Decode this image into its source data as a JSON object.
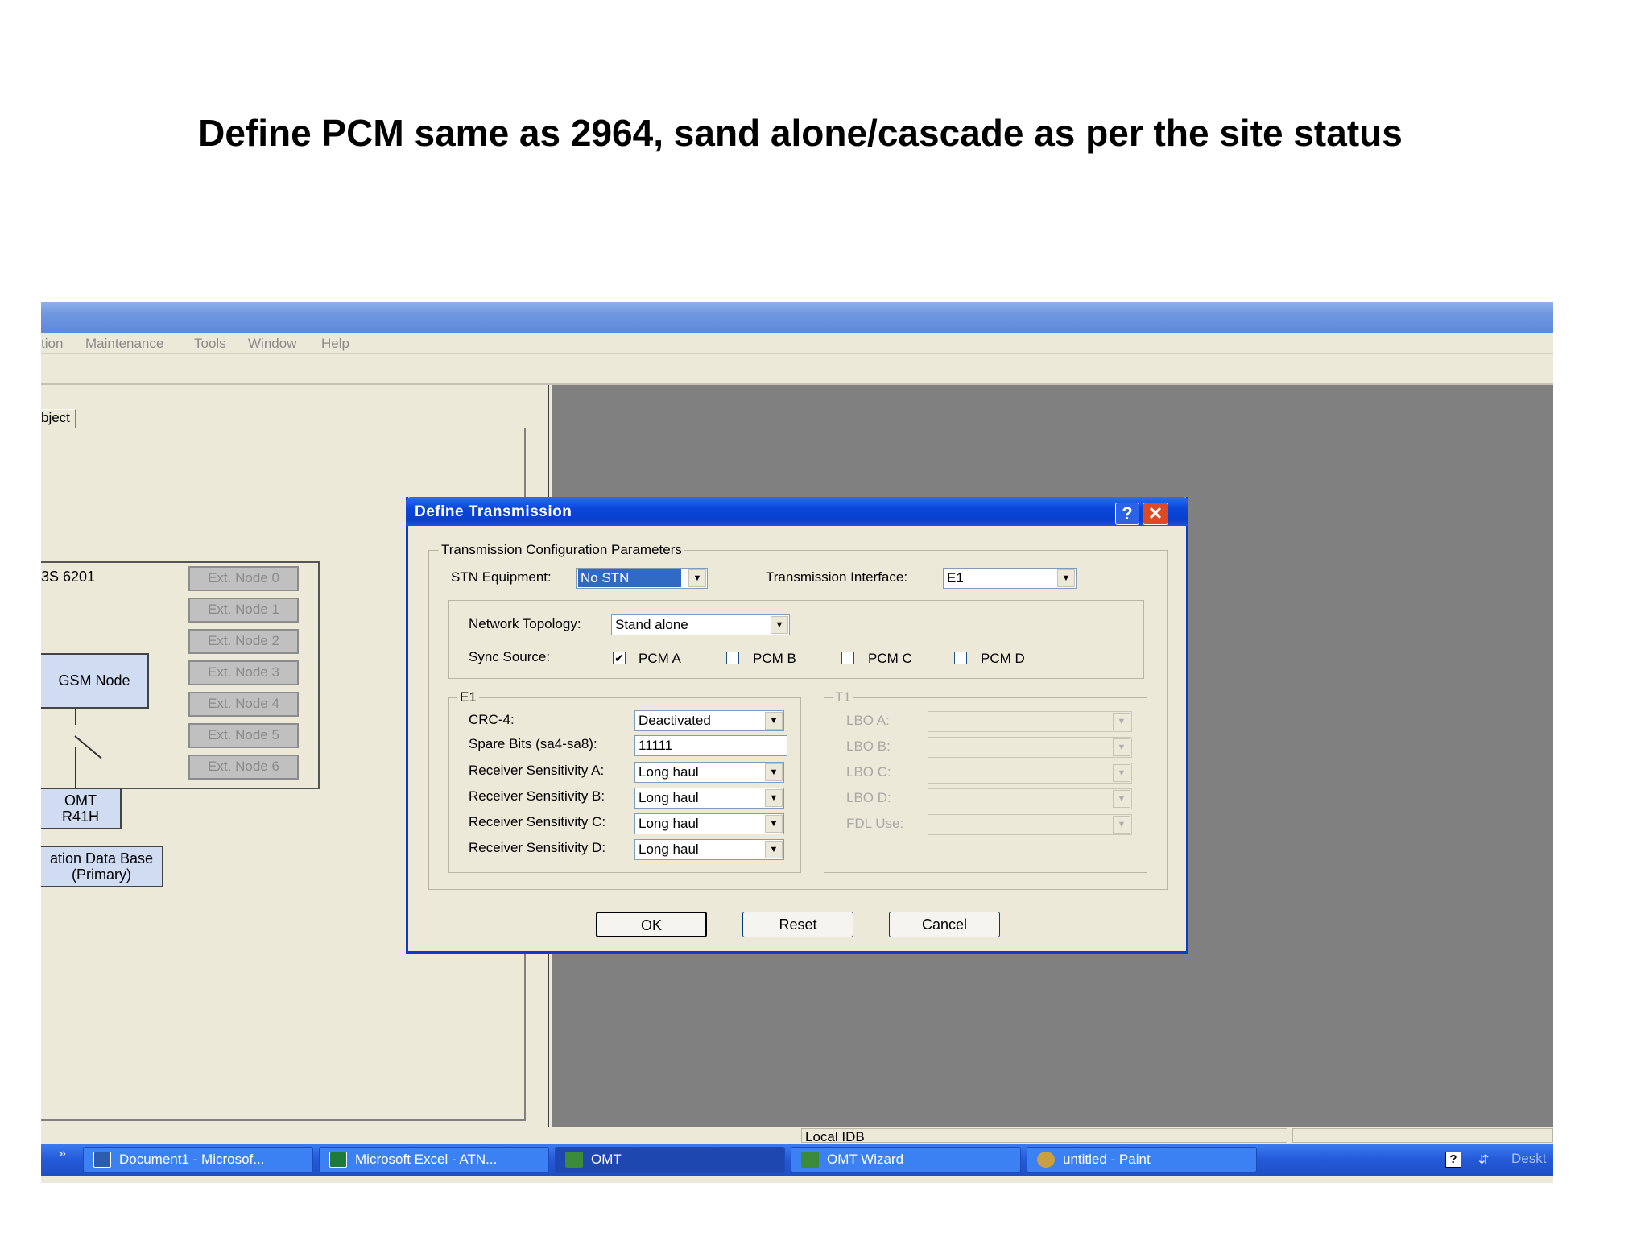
{
  "slide": {
    "title": "Define PCM  same as 2964, sand alone/cascade as per the site status"
  },
  "menu": [
    "tion",
    "Maintenance",
    "Tools",
    "Window",
    "Help"
  ],
  "left_pane": {
    "tab_label": "bject",
    "bts_label": "3S 6201",
    "ext_nodes": [
      "Ext. Node 0",
      "Ext. Node 1",
      "Ext. Node 2",
      "Ext. Node 3",
      "Ext. Node 4",
      "Ext. Node 5",
      "Ext. Node 6"
    ],
    "gsm_node": "GSM Node",
    "omt_line1": "OMT",
    "omt_line2": "R41H",
    "db_line1": "ation Data Base",
    "db_line2": "(Primary)"
  },
  "dialog": {
    "title": "Define Transmission",
    "help_label": "?",
    "close_label": "✕",
    "group_main": "Transmission Configuration Parameters",
    "stn_label": "STN Equipment:",
    "stn_value": "No STN",
    "interface_label": "Transmission Interface:",
    "interface_value": "E1",
    "topology_label": "Network Topology:",
    "topology_value": "Stand alone",
    "sync_label": "Sync Source:",
    "sync_options": [
      {
        "label": "PCM A",
        "checked": true
      },
      {
        "label": "PCM B",
        "checked": false
      },
      {
        "label": "PCM C",
        "checked": false
      },
      {
        "label": "PCM D",
        "checked": false
      }
    ],
    "e1": {
      "legend": "E1",
      "crc_label": "CRC-4:",
      "crc_value": "Deactivated",
      "spare_label": "Spare Bits (sa4-sa8):",
      "spare_value": "11111",
      "rx_a_label": "Receiver Sensitivity A:",
      "rx_a_value": "Long haul",
      "rx_b_label": "Receiver Sensitivity B:",
      "rx_b_value": "Long haul",
      "rx_c_label": "Receiver Sensitivity C:",
      "rx_c_value": "Long haul",
      "rx_d_label": "Receiver Sensitivity D:",
      "rx_d_value": "Long haul"
    },
    "t1": {
      "legend": "T1",
      "lbo_a": "LBO A:",
      "lbo_b": "LBO B:",
      "lbo_c": "LBO C:",
      "lbo_d": "LBO D:",
      "fdl": "FDL Use:"
    },
    "ok": "OK",
    "reset": "Reset",
    "cancel": "Cancel"
  },
  "status": {
    "idb": "Local IDB"
  },
  "taskbar": {
    "chevron": "»",
    "items": [
      {
        "label": "Document1 - Microsof...",
        "icon_color": "#2a5db0"
      },
      {
        "label": "Microsoft Excel - ATN...",
        "icon_color": "#1d7a3a"
      },
      {
        "label": "OMT",
        "icon_color": "#3a8a3a"
      },
      {
        "label": "OMT Wizard",
        "icon_color": "#3a8a3a"
      },
      {
        "label": "untitled - Paint",
        "icon_color": "#c8a040"
      }
    ],
    "tray_text": "Deskt",
    "tray_help": "?"
  },
  "colors": {
    "xp_blue": "#0a40cc",
    "workspace_gray": "#808080",
    "dialog_bg": "#ece9d8"
  }
}
